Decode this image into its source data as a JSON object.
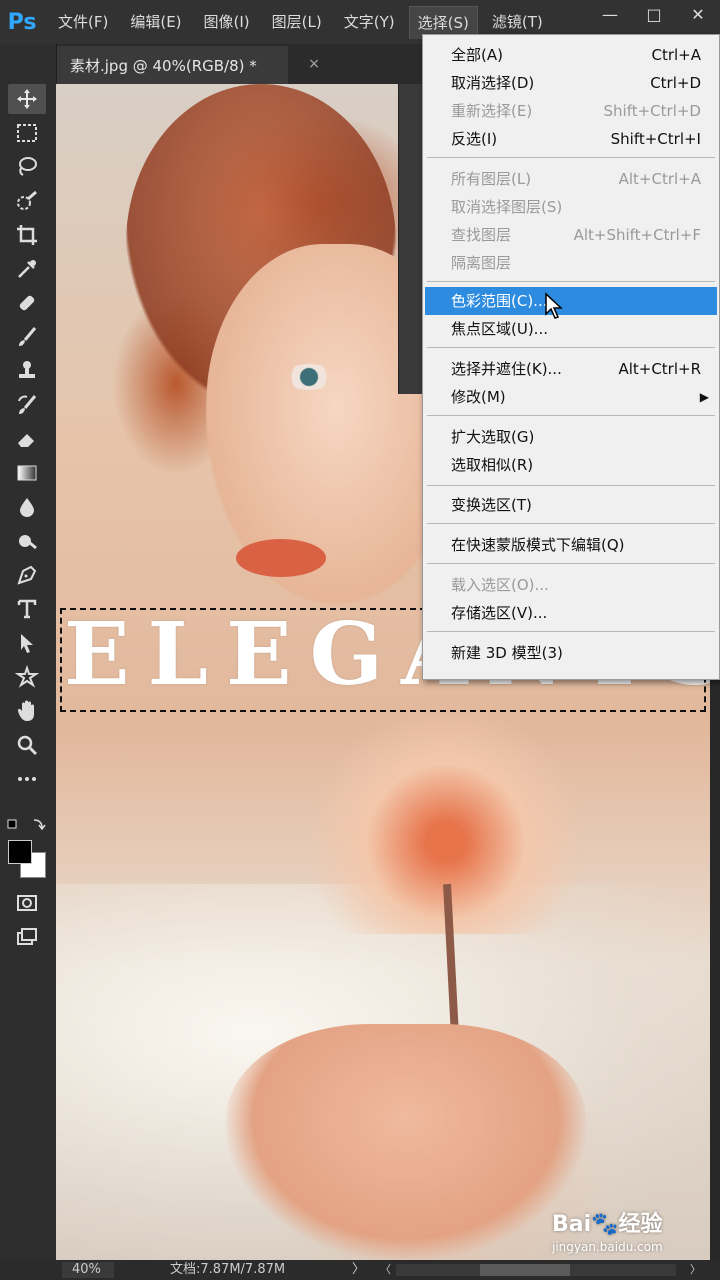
{
  "app": {
    "logo": "Ps"
  },
  "menubar": {
    "items": [
      "文件(F)",
      "编辑(E)",
      "图像(I)",
      "图层(L)",
      "文字(Y)",
      "选择(S)",
      "滤镜(T)"
    ],
    "active_index": 5
  },
  "window_controls": {
    "minimize": "—",
    "maximize": "□",
    "close": "✕"
  },
  "document": {
    "tab_title": "素材.jpg @ 40%(RGB/8) *",
    "tab_close": "×",
    "overlay_text": "ELEGANTS"
  },
  "toolbar": {
    "tools": [
      "move-icon",
      "marquee-icon",
      "lasso-icon",
      "quick-select-icon",
      "crop-icon",
      "eyedropper-icon",
      "healing-brush-icon",
      "brush-icon",
      "clone-stamp-icon",
      "history-brush-icon",
      "eraser-icon",
      "gradient-icon",
      "blur-icon",
      "dodge-icon",
      "pen-icon",
      "type-icon",
      "path-select-icon",
      "shape-icon",
      "hand-icon",
      "zoom-icon",
      "more-tools-icon"
    ],
    "foreground_color": "#000000",
    "background_color": "#ffffff"
  },
  "dropdown": {
    "items": [
      {
        "label": "全部(A)",
        "shortcut": "Ctrl+A",
        "disabled": false
      },
      {
        "label": "取消选择(D)",
        "shortcut": "Ctrl+D",
        "disabled": false
      },
      {
        "label": "重新选择(E)",
        "shortcut": "Shift+Ctrl+D",
        "disabled": true
      },
      {
        "label": "反选(I)",
        "shortcut": "Shift+Ctrl+I",
        "disabled": false
      },
      {
        "label": "所有图层(L)",
        "shortcut": "Alt+Ctrl+A",
        "disabled": true
      },
      {
        "label": "取消选择图层(S)",
        "shortcut": "",
        "disabled": true
      },
      {
        "label": "查找图层",
        "shortcut": "Alt+Shift+Ctrl+F",
        "disabled": true
      },
      {
        "label": "隔离图层",
        "shortcut": "",
        "disabled": true
      },
      {
        "label": "色彩范围(C)...",
        "shortcut": "",
        "disabled": false,
        "highlighted": true
      },
      {
        "label": "焦点区域(U)...",
        "shortcut": "",
        "disabled": false
      },
      {
        "label": "选择并遮住(K)...",
        "shortcut": "Alt+Ctrl+R",
        "disabled": false
      },
      {
        "label": "修改(M)",
        "shortcut": "",
        "disabled": false,
        "submenu": true
      },
      {
        "label": "扩大选取(G)",
        "shortcut": "",
        "disabled": false
      },
      {
        "label": "选取相似(R)",
        "shortcut": "",
        "disabled": false
      },
      {
        "label": "变换选区(T)",
        "shortcut": "",
        "disabled": false
      },
      {
        "label": "在快速蒙版模式下编辑(Q)",
        "shortcut": "",
        "disabled": false
      },
      {
        "label": "载入选区(O)...",
        "shortcut": "",
        "disabled": true
      },
      {
        "label": "存储选区(V)...",
        "shortcut": "",
        "disabled": false
      },
      {
        "label": "新建 3D 模型(3)",
        "shortcut": "",
        "disabled": false
      }
    ],
    "submenu_arrow": "▶"
  },
  "statusbar": {
    "zoom": "40%",
    "doc_size": "文档:7.87M/7.87M",
    "arrow": "〉",
    "scroll_left": "〈",
    "scroll_right": "〉"
  },
  "watermark": {
    "logo": "Bai🐾经验",
    "url": "jingyan.baidu.com"
  },
  "colors": {
    "highlight": "#2e8ce0",
    "ps_blue": "#31a8ff",
    "menu_bg": "#f0f0f0"
  }
}
